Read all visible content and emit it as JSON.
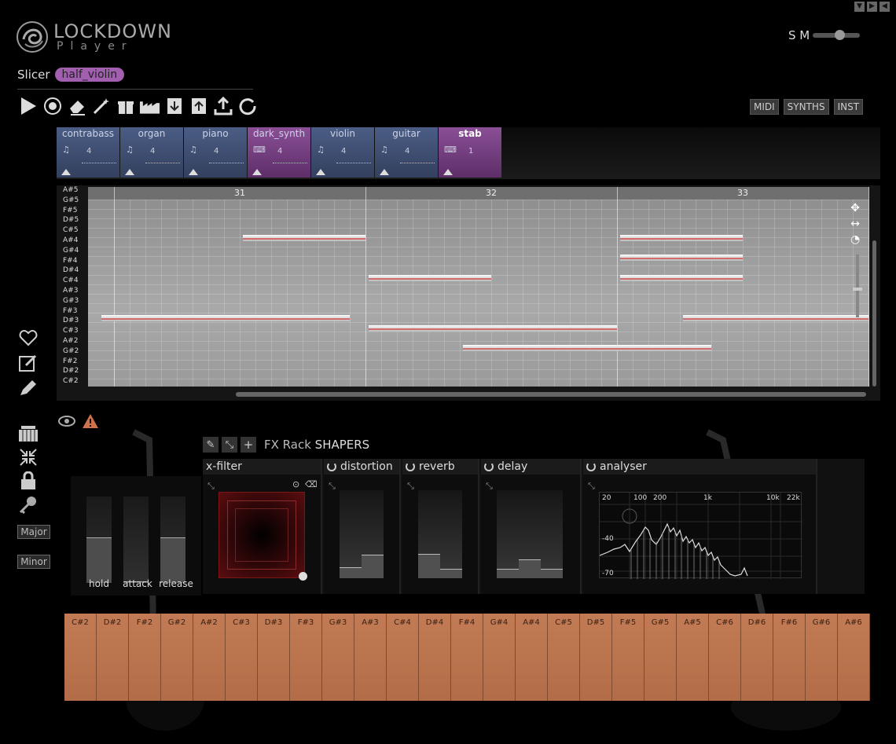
{
  "app": {
    "brand": "LOCKDOWN",
    "subbrand": "Player",
    "sm_label": "S M"
  },
  "window_controls": [
    "▼",
    "▶",
    "◀"
  ],
  "slicer": {
    "label": "Slicer",
    "value": "half_violin"
  },
  "mode_buttons": [
    "MIDI",
    "SYNTHS",
    "INST"
  ],
  "instruments": [
    {
      "name": "contrabass",
      "count": "4",
      "icon": "music-note-icon",
      "color": "blue"
    },
    {
      "name": "organ",
      "count": "4",
      "icon": "music-note-icon",
      "color": "blue"
    },
    {
      "name": "piano",
      "count": "4",
      "icon": "music-note-icon",
      "color": "blue"
    },
    {
      "name": "dark_synth",
      "count": "4",
      "icon": "keyboard-icon",
      "color": "purple"
    },
    {
      "name": "violin",
      "count": "4",
      "icon": "music-note-icon",
      "color": "blue"
    },
    {
      "name": "guitar",
      "count": "4",
      "icon": "music-note-icon",
      "color": "blue"
    },
    {
      "name": "stab",
      "count": "1",
      "icon": "keyboard-icon",
      "color": "purple",
      "active": true
    }
  ],
  "piano_roll": {
    "note_labels": [
      "A#5",
      "G#5",
      "F#5",
      "D#5",
      "C#5",
      "A#4",
      "G#4",
      "F#4",
      "D#4",
      "C#4",
      "A#3",
      "G#3",
      "F#3",
      "D#3",
      "C#3",
      "A#2",
      "G#2",
      "F#2",
      "D#2",
      "C#2"
    ],
    "bars": [
      "31",
      "32",
      "33"
    ]
  },
  "scales": {
    "major": "Major",
    "minor": "Minor"
  },
  "envelope": {
    "hold": "hold",
    "attack": "attack",
    "release": "release",
    "hold_level": 0.58,
    "attack_level": 0.02,
    "release_level": 0.58
  },
  "fx_rack": {
    "title": "FX Rack",
    "preset": "SHAPERS",
    "modules": [
      "x-filter",
      "distortion",
      "reverb",
      "delay",
      "analyser"
    ],
    "analyser": {
      "freq_labels": [
        "20",
        "100",
        "200",
        "1k",
        "10k",
        "22k"
      ],
      "db_labels": [
        "-40",
        "-70"
      ]
    }
  },
  "keyboard_keys": [
    "C#2",
    "D#2",
    "F#2",
    "G#2",
    "A#2",
    "C#3",
    "D#3",
    "F#3",
    "G#3",
    "A#3",
    "C#4",
    "D#4",
    "F#4",
    "G#4",
    "A#4",
    "C#5",
    "D#5",
    "F#5",
    "G#5",
    "A#5",
    "C#6",
    "D#6",
    "F#6",
    "G#6",
    "A#6"
  ]
}
